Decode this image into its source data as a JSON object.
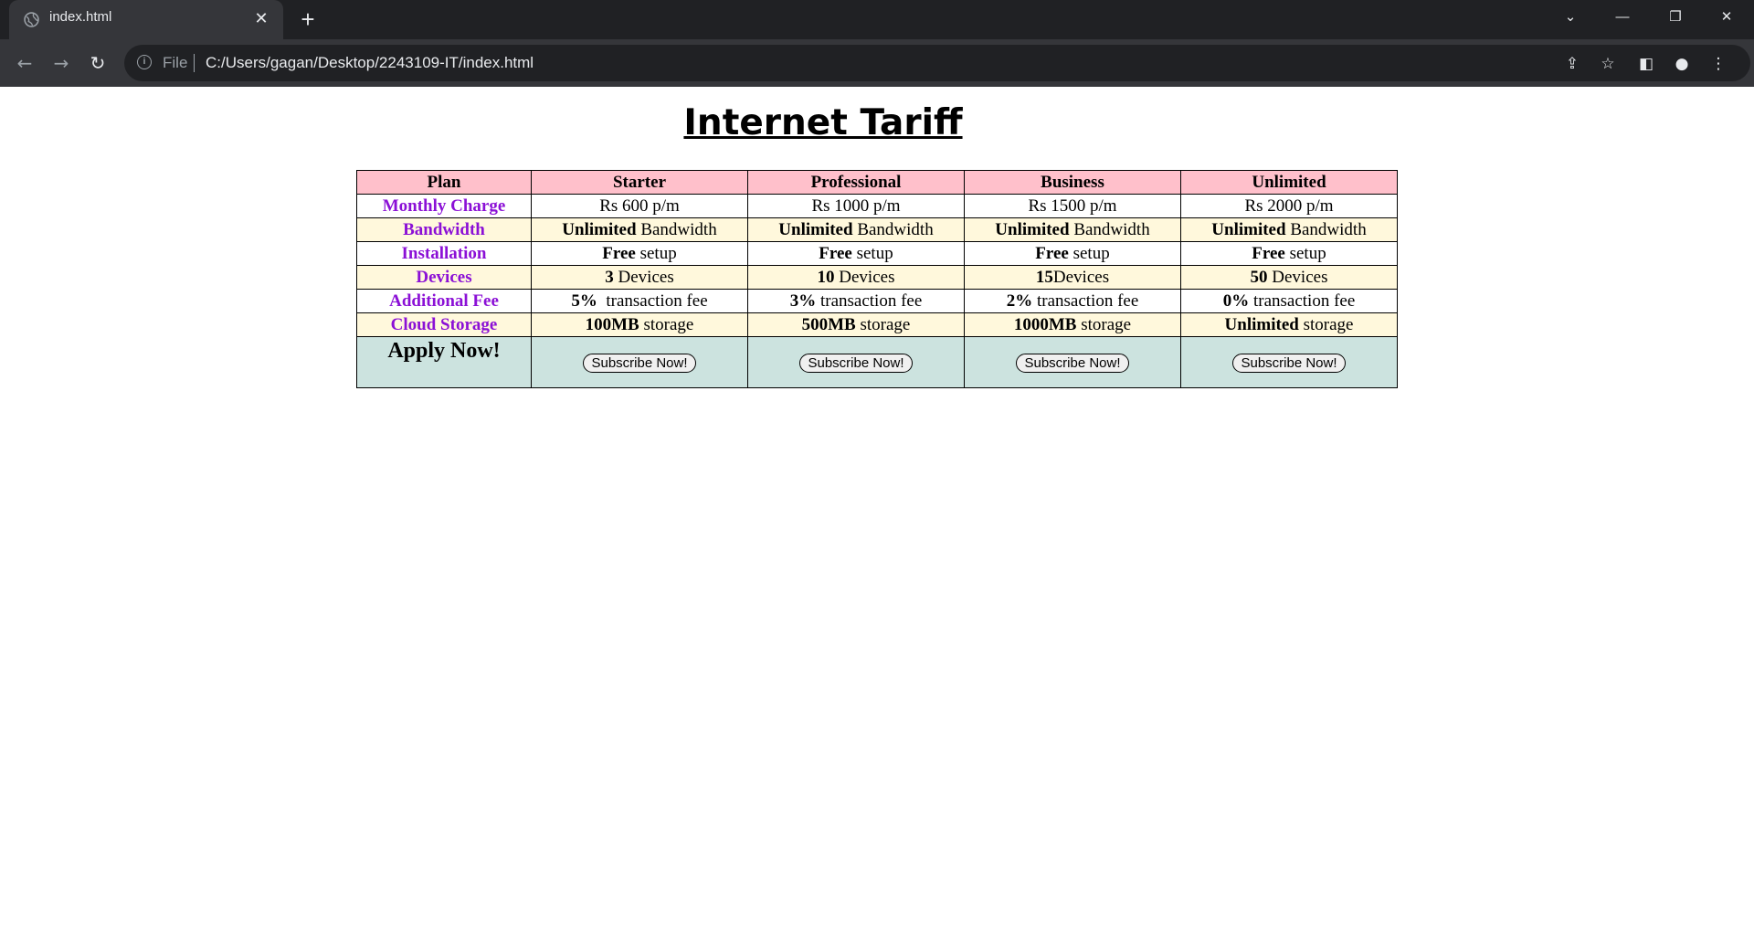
{
  "browser": {
    "tab_title": "index.html",
    "address_scheme": "File",
    "address_url": "C:/Users/gagan/Desktop/2243109-IT/index.html"
  },
  "page": {
    "title": "Internet Tariff",
    "table": {
      "header": [
        "Plan",
        "Starter",
        "Professional",
        "Business",
        "Unlimited"
      ],
      "rows": [
        {
          "label": "Monthly Charge",
          "cells": [
            {
              "bold": "",
              "text": "Rs 600 p/m"
            },
            {
              "bold": "",
              "text": "Rs 1000 p/m"
            },
            {
              "bold": "",
              "text": "Rs 1500 p/m"
            },
            {
              "bold": "",
              "text": "Rs 2000 p/m"
            }
          ]
        },
        {
          "label": "Bandwidth",
          "cells": [
            {
              "bold": "Unlimited",
              "text": " Bandwidth"
            },
            {
              "bold": "Unlimited",
              "text": " Bandwidth"
            },
            {
              "bold": "Unlimited",
              "text": " Bandwidth"
            },
            {
              "bold": "Unlimited",
              "text": " Bandwidth"
            }
          ]
        },
        {
          "label": "Installation",
          "cells": [
            {
              "bold": "Free",
              "text": " setup"
            },
            {
              "bold": "Free",
              "text": " setup"
            },
            {
              "bold": "Free",
              "text": " setup"
            },
            {
              "bold": "Free",
              "text": " setup"
            }
          ]
        },
        {
          "label": "Devices",
          "cells": [
            {
              "bold": "3",
              "text": " Devices"
            },
            {
              "bold": "10",
              "text": " Devices"
            },
            {
              "bold": "15",
              "text": "Devices"
            },
            {
              "bold": "50",
              "text": " Devices"
            }
          ]
        },
        {
          "label": "Additional Fee",
          "cells": [
            {
              "bold": "5%",
              "text": "  transaction fee"
            },
            {
              "bold": "3%",
              "text": " transaction fee"
            },
            {
              "bold": "2%",
              "text": " transaction fee"
            },
            {
              "bold": "0%",
              "text": " transaction fee"
            }
          ]
        },
        {
          "label": "Cloud Storage",
          "cells": [
            {
              "bold": "100MB",
              "text": " storage"
            },
            {
              "bold": "500MB",
              "text": " storage"
            },
            {
              "bold": "1000MB",
              "text": " storage"
            },
            {
              "bold": "Unlimited",
              "text": " storage"
            }
          ]
        }
      ],
      "apply_label": "Apply Now!",
      "subscribe_label": "Subscribe Now!"
    }
  }
}
